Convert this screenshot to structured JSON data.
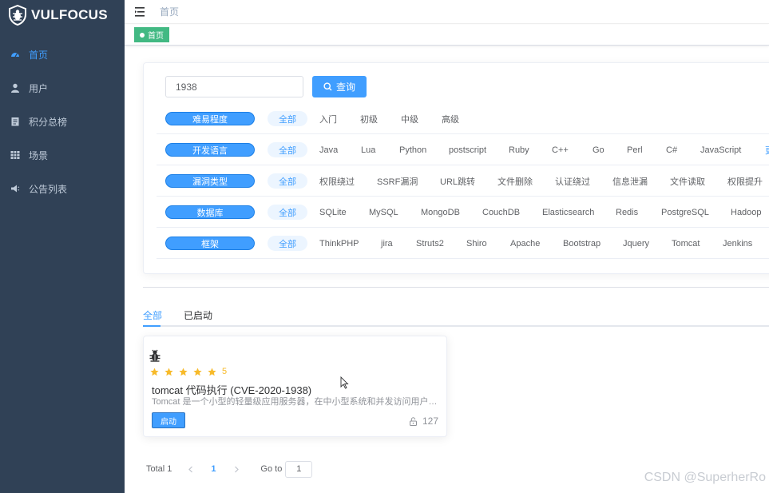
{
  "app": {
    "logo_text": "VULFOCUS"
  },
  "sidebar": {
    "items": [
      {
        "label": "首页",
        "icon": "dashboard-icon"
      },
      {
        "label": "用户",
        "icon": "user-icon"
      },
      {
        "label": "积分总榜",
        "icon": "clipboard-icon"
      },
      {
        "label": "场景",
        "icon": "grid-icon"
      },
      {
        "label": "公告列表",
        "icon": "speaker-icon"
      }
    ],
    "active_index": 0
  },
  "navbar": {
    "breadcrumb": "首页"
  },
  "tagsbar": {
    "tag": "首页"
  },
  "search": {
    "value": "1938",
    "button_label": "查询"
  },
  "filters": {
    "all_label": "全部",
    "rows": [
      {
        "label": "难易程度",
        "options": [
          "入门",
          "初级",
          "中级",
          "高级"
        ]
      },
      {
        "label": "开发语言",
        "options": [
          "Java",
          "Lua",
          "Python",
          "postscript",
          "Ruby",
          "C++",
          "Go",
          "Perl",
          "C#",
          "JavaScript"
        ],
        "more": "更"
      },
      {
        "label": "漏洞类型",
        "options": [
          "权限绕过",
          "SSRF漏洞",
          "URL跳转",
          "文件删除",
          "认证绕过",
          "信息泄漏",
          "文件读取",
          "权限提升"
        ]
      },
      {
        "label": "数据库",
        "options": [
          "SQLite",
          "MySQL",
          "MongoDB",
          "CouchDB",
          "Elasticsearch",
          "Redis",
          "PostgreSQL",
          "Hadoop"
        ]
      },
      {
        "label": "框架",
        "options": [
          "ThinkPHP",
          "jira",
          "Struts2",
          "Shiro",
          "Apache",
          "Bootstrap",
          "Jquery",
          "Tomcat",
          "Jenkins"
        ]
      }
    ]
  },
  "tabs": [
    {
      "label": "全部"
    },
    {
      "label": "已启动"
    }
  ],
  "card": {
    "rating": 5,
    "rating_label": "5",
    "title": "tomcat 代码执行 (CVE-2020-1938)",
    "desc": "Tomcat 是一个小型的轻量级应用服务器，在中小型系统和并发访问用户不是很多...",
    "start_label": "启动",
    "count": "127",
    "star_color": "#f7ba2a"
  },
  "pagination": {
    "total": "Total 1",
    "current": "1",
    "goto_label": "Go to",
    "goto_value": "1"
  },
  "watermark": "CSDN @SuperherRo",
  "colors": {
    "sidebar_bg": "#304156",
    "primary": "#409eff",
    "tag_green": "#42b983"
  }
}
